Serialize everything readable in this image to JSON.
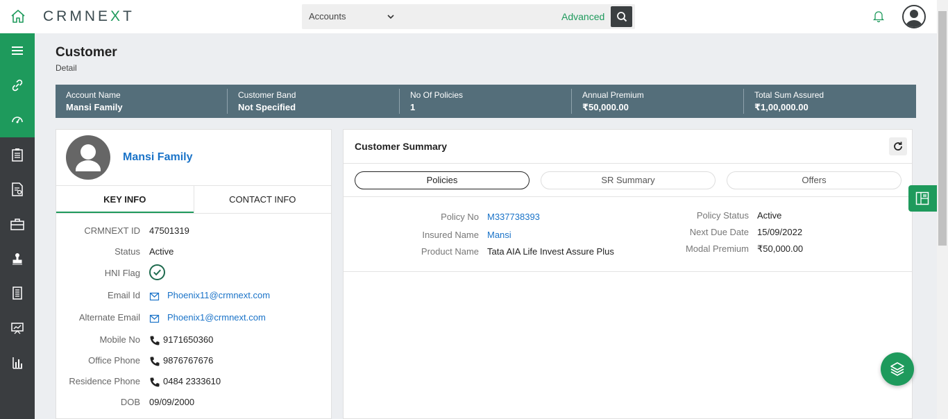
{
  "app": {
    "logo_pre": "CRMNE",
    "logo_x": "X",
    "logo_post": "T"
  },
  "search": {
    "selected": "Accounts",
    "advanced_label": "Advanced"
  },
  "page": {
    "title": "Customer",
    "subtitle": "Detail"
  },
  "banner": [
    {
      "label": "Account Name",
      "value": "Mansi Family"
    },
    {
      "label": "Customer Band",
      "value": "Not Specified"
    },
    {
      "label": "No Of Policies",
      "value": "1"
    },
    {
      "label": "Annual Premium",
      "value": "₹50,000.00"
    },
    {
      "label": "Total Sum Assured",
      "value": "₹1,00,000.00"
    }
  ],
  "profile": {
    "name": "Mansi Family",
    "tabs": [
      "KEY INFO",
      "CONTACT INFO"
    ],
    "fields": {
      "crmnext_id": {
        "label": "CRMNEXT ID",
        "value": "47501319"
      },
      "status": {
        "label": "Status",
        "value": "Active"
      },
      "hni_flag": {
        "label": "HNI Flag"
      },
      "email": {
        "label": "Email Id",
        "value": "Phoenix11@crmnext.com"
      },
      "alt_email": {
        "label": "Alternate Email",
        "value": "Phoenix1@crmnext.com"
      },
      "mobile": {
        "label": "Mobile No",
        "value": "9171650360"
      },
      "office_phone": {
        "label": "Office Phone",
        "value": "9876767676"
      },
      "residence_phone": {
        "label": "Residence Phone",
        "value": "0484 2333610"
      },
      "dob": {
        "label": "DOB",
        "value": "09/09/2000"
      }
    }
  },
  "summary": {
    "title": "Customer Summary",
    "pills": [
      "Policies",
      "SR Summary",
      "Offers"
    ],
    "policy": {
      "policy_no": {
        "label": "Policy No",
        "value": "M337738393"
      },
      "insured_name": {
        "label": "Insured Name",
        "value": "Mansi"
      },
      "product_name": {
        "label": "Product Name",
        "value": "Tata AIA Life Invest Assure Plus"
      },
      "policy_status": {
        "label": "Policy Status",
        "value": "Active"
      },
      "next_due_date": {
        "label": "Next Due Date",
        "value": "15/09/2022"
      },
      "modal_premium": {
        "label": "Modal Premium",
        "value": "₹50,000.00"
      }
    }
  },
  "colors": {
    "brand_green": "#1e9a5c",
    "banner_bg": "#546e7a",
    "nav_dark": "#3a3d40",
    "link_blue": "#1a73c8"
  },
  "icons": {
    "nav": [
      "hamburger-icon",
      "link-icon",
      "dashboard-icon",
      "clipboard-icon",
      "document-icon",
      "briefcase-icon",
      "stamp-icon",
      "receipt-icon",
      "presentation-icon",
      "bar-chart-icon"
    ]
  }
}
